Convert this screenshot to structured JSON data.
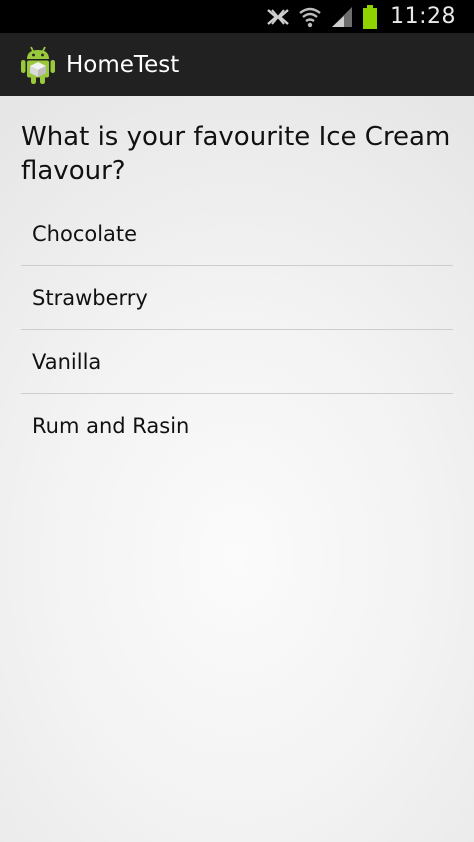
{
  "status_bar": {
    "icons": [
      "nfc-icon",
      "wifi-icon",
      "signal-icon",
      "battery-icon"
    ],
    "time": "11:28"
  },
  "action_bar": {
    "icon": "android-icon",
    "title": "HomeTest"
  },
  "question": "What is your favourite Ice Cream flavour?",
  "options": [
    {
      "label": "Chocolate"
    },
    {
      "label": "Strawberry"
    },
    {
      "label": "Vanilla"
    },
    {
      "label": "Rum and Rasin"
    }
  ],
  "colors": {
    "status_bar_bg": "#000000",
    "action_bar_bg": "#212121",
    "battery": "#8fd400",
    "android_green": "#9ac93c"
  }
}
